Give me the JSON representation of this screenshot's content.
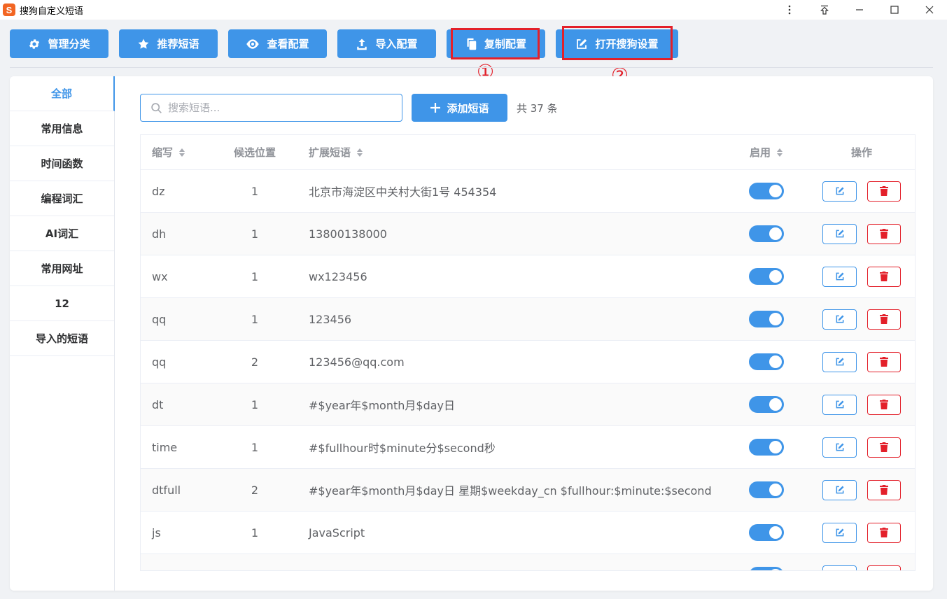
{
  "window": {
    "logo_letter": "S",
    "title": "搜狗自定义短语"
  },
  "toolbar": {
    "manage_label": "管理分类",
    "recommend_label": "推荐短语",
    "view_label": "查看配置",
    "import_label": "导入配置",
    "copy_label": "复制配置",
    "open_label": "打开搜狗设置"
  },
  "annotations": {
    "marker_1": "①",
    "marker_2": "②"
  },
  "sidebar": {
    "items": [
      {
        "label": "全部",
        "active": true
      },
      {
        "label": "常用信息"
      },
      {
        "label": "时间函数"
      },
      {
        "label": "编程词汇"
      },
      {
        "label": "AI词汇"
      },
      {
        "label": "常用网址"
      },
      {
        "label": "12"
      },
      {
        "label": "导入的短语"
      }
    ]
  },
  "search": {
    "placeholder": "搜索短语..."
  },
  "add_button": {
    "label": "添加短语"
  },
  "count_text": "共 37 条",
  "table": {
    "headers": {
      "abbr": "缩写",
      "position": "候选位置",
      "expansion": "扩展短语",
      "enabled": "启用",
      "actions": "操作"
    },
    "rows": [
      {
        "abbr": "dz",
        "position": "1",
        "expansion": "北京市海淀区中关村大街1号 454354",
        "enabled": true
      },
      {
        "abbr": "dh",
        "position": "1",
        "expansion": "13800138000",
        "enabled": true
      },
      {
        "abbr": "wx",
        "position": "1",
        "expansion": "wx123456",
        "enabled": true
      },
      {
        "abbr": "qq",
        "position": "1",
        "expansion": "123456",
        "enabled": true
      },
      {
        "abbr": "qq",
        "position": "2",
        "expansion": "123456@qq.com",
        "enabled": true
      },
      {
        "abbr": "dt",
        "position": "1",
        "expansion": "#$year年$month月$day日",
        "enabled": true
      },
      {
        "abbr": "time",
        "position": "1",
        "expansion": "#$fullhour时$minute分$second秒",
        "enabled": true
      },
      {
        "abbr": "dtfull",
        "position": "2",
        "expansion": "#$year年$month月$day日 星期$weekday_cn $fullhour:$minute:$second",
        "enabled": true
      },
      {
        "abbr": "js",
        "position": "1",
        "expansion": "JavaScript",
        "enabled": true
      },
      {
        "abbr": "",
        "position": "",
        "expansion": "",
        "enabled": true
      }
    ]
  },
  "colors": {
    "primary": "#3f95e8",
    "danger": "#e3202a",
    "logo": "#f26522"
  }
}
